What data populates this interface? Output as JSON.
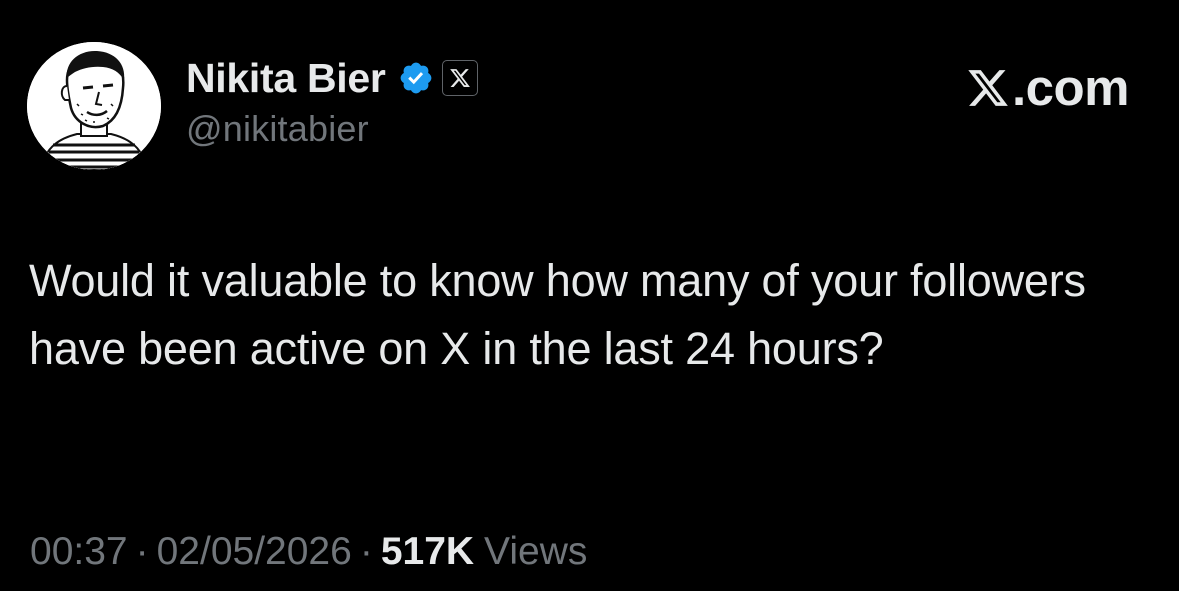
{
  "author": {
    "display_name": "Nikita Bier",
    "handle": "@nikitabier",
    "verified_badge_color": "#1d9bf0",
    "affiliation_icon": "x-logo-icon",
    "avatar_icon": "sketch-portrait-avatar"
  },
  "brand": {
    "icon": "x-logo-icon",
    "text": ".com"
  },
  "tweet": {
    "text": "Would it valuable to know how many of your followers have been active on X in the last 24 hours?"
  },
  "meta": {
    "time": "00:37",
    "separator": "·",
    "date": "02/05/2026",
    "views_count": "517K",
    "views_label": "Views"
  },
  "colors": {
    "background": "#000000",
    "primary_text": "#e7e9ea",
    "secondary_text": "#71767b"
  }
}
